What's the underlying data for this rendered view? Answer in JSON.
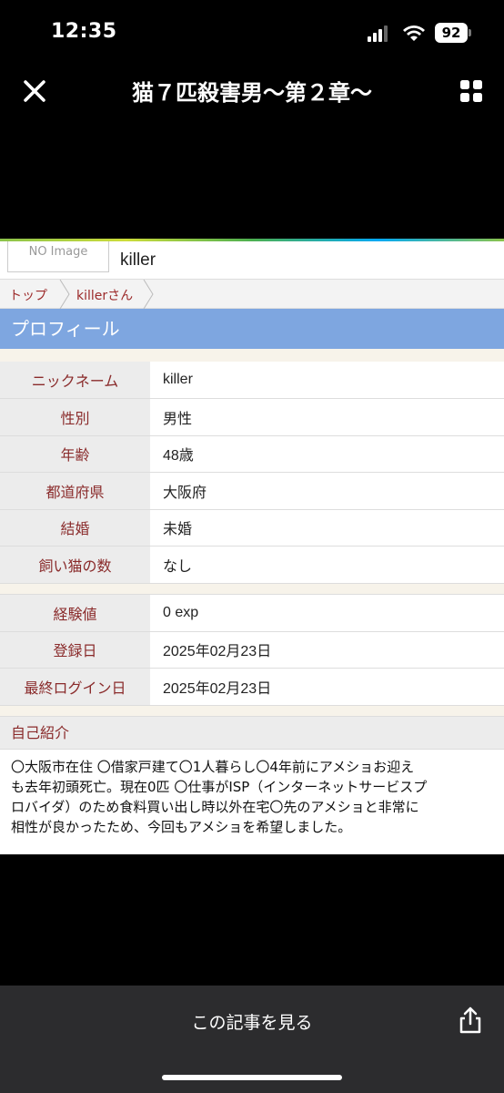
{
  "status": {
    "time": "12:35",
    "battery": "92"
  },
  "header": {
    "title": "猫７匹殺害男〜第２章〜",
    "close_icon": "close-icon",
    "grid_icon": "grid-icon"
  },
  "user": {
    "noimage": "NO Image",
    "name": "killer"
  },
  "breadcrumb": {
    "home": "トップ",
    "current": "killerさん"
  },
  "section": {
    "profile": "プロフィール"
  },
  "profile": {
    "rows": [
      {
        "k": "ニックネーム",
        "v": "killer"
      },
      {
        "k": "性別",
        "v": "男性"
      },
      {
        "k": "年齢",
        "v": "48歳"
      },
      {
        "k": "都道府県",
        "v": "大阪府"
      },
      {
        "k": "結婚",
        "v": "未婚"
      },
      {
        "k": "飼い猫の数",
        "v": "なし"
      }
    ],
    "stats": [
      {
        "k": "経験値",
        "v": "0 exp"
      },
      {
        "k": "登録日",
        "v": "2025年02月23日"
      },
      {
        "k": "最終ログイン日",
        "v": "2025年02月23日"
      }
    ]
  },
  "intro": {
    "title": "自己紹介",
    "lines": [
      "〇大阪市在住 〇借家戸建て〇1人暮らし〇4年前にアメショお迎え",
      "も去年初頭死亡。現在0匹 〇仕事がISP（インターネットサービスプ",
      "ロバイダ）のため食料買い出し時以外在宅〇先のアメショと非常に",
      "相性が良かったため、今回もアメショを希望しました。"
    ]
  },
  "bottom": {
    "view_label": "この記事を見る",
    "share_icon": "share-icon"
  },
  "colors": {
    "accent": "#7ea6e0",
    "label": "#8a2b2b",
    "bottom_bar": "#2c2c2e"
  }
}
